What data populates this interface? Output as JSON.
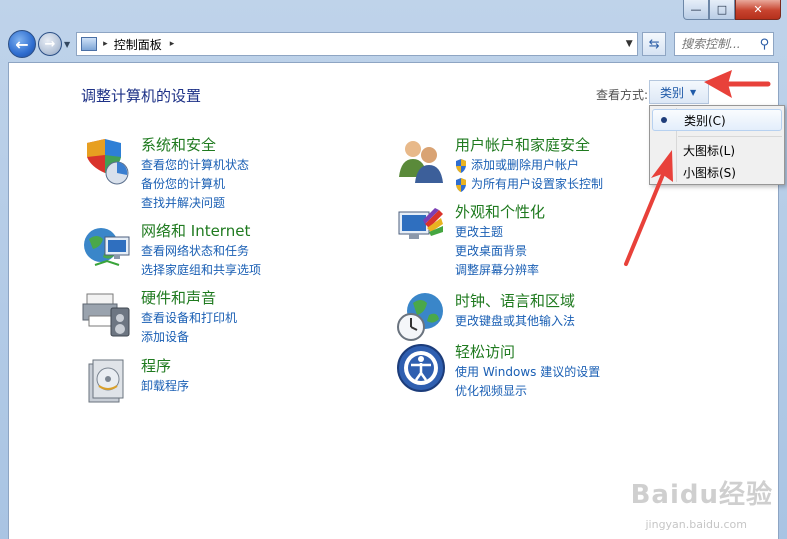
{
  "window": {
    "minimize_glyph": "—",
    "maximize_glyph": "□",
    "close_glyph": "✕"
  },
  "navbar": {
    "back_glyph": "←",
    "forward_glyph": "→",
    "address_crumb": "控制面板",
    "crumb_separator": "▸",
    "dropdown_glyph": "▼",
    "refresh_glyph": "⇆",
    "search_placeholder": "搜索控制...",
    "search_icon": "search-icon"
  },
  "content": {
    "heading": "调整计算机的设置",
    "view_by_label": "查看方式:",
    "view_by_value": "类别",
    "caret_glyph": "▼"
  },
  "categories_left": [
    {
      "title": "系统和安全",
      "icon": "system-security-icon",
      "links": [
        "查看您的计算机状态",
        "备份您的计算机",
        "查找并解决问题"
      ]
    },
    {
      "title": "网络和 Internet",
      "icon": "network-internet-icon",
      "links": [
        "查看网络状态和任务",
        "选择家庭组和共享选项"
      ]
    },
    {
      "title": "硬件和声音",
      "icon": "hardware-sound-icon",
      "links": [
        "查看设备和打印机",
        "添加设备"
      ]
    },
    {
      "title": "程序",
      "icon": "programs-icon",
      "links": [
        "卸载程序"
      ]
    }
  ],
  "categories_right": [
    {
      "title": "用户帐户和家庭安全",
      "icon": "user-accounts-icon",
      "links": [
        "添加或删除用户帐户",
        "为所有用户设置家长控制"
      ],
      "shielded": true
    },
    {
      "title": "外观和个性化",
      "icon": "appearance-icon",
      "links": [
        "更改主题",
        "更改桌面背景",
        "调整屏幕分辨率"
      ]
    },
    {
      "title": "时钟、语言和区域",
      "icon": "clock-language-icon",
      "links": [
        "更改键盘或其他输入法"
      ]
    },
    {
      "title": "轻松访问",
      "icon": "ease-of-access-icon",
      "links": [
        "使用 Windows 建议的设置",
        "优化视频显示"
      ]
    }
  ],
  "view_menu": {
    "items": [
      "类别(C)",
      "大图标(L)",
      "小图标(S)"
    ],
    "selected": "类别(C)"
  },
  "annotation": {
    "arrow_color": "#e8413a"
  },
  "watermark": {
    "logo_text": "Baidu经验",
    "url_text": "jingyan.baidu.com"
  }
}
